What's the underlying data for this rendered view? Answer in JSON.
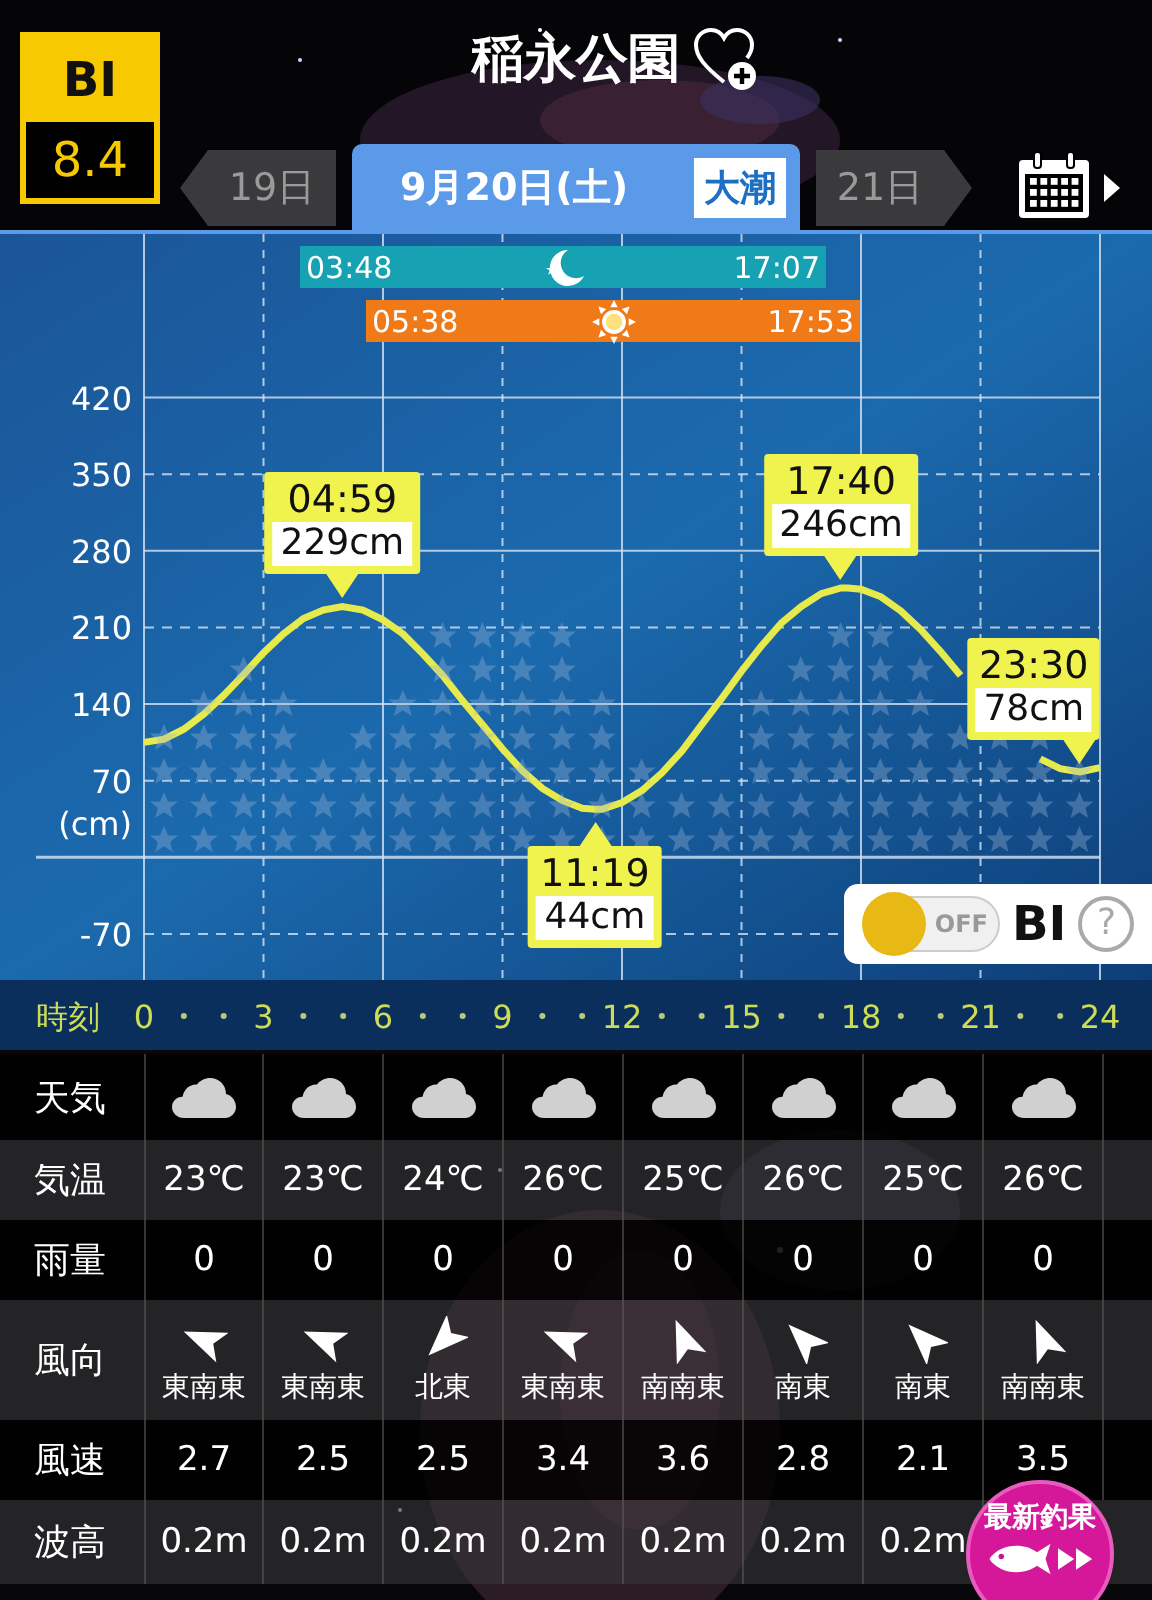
{
  "bi_badge": {
    "label": "BI",
    "score": "8.4"
  },
  "title": "稲永公園",
  "date_tabs": [
    {
      "kind": "prev",
      "label": "19日",
      "selected": false
    },
    {
      "kind": "current",
      "label": "9月20日(土)",
      "tide": "大潮",
      "selected": true
    },
    {
      "kind": "next",
      "label": "21日",
      "selected": false
    }
  ],
  "sun_moon": [
    {
      "kind": "moon",
      "rise": "03:48",
      "set": "17:07"
    },
    {
      "kind": "sun",
      "rise": "05:38",
      "set": "17:53"
    }
  ],
  "tide_chart": {
    "chart_data": {
      "type": "line",
      "xlabel": "時刻",
      "ylabel": "(cm)",
      "grid": true,
      "x": [
        0,
        0.5,
        1,
        1.5,
        2,
        2.5,
        3,
        3.5,
        4,
        4.5,
        4.98,
        5.5,
        6,
        6.5,
        7,
        7.5,
        8,
        8.5,
        9,
        9.5,
        10,
        10.5,
        11,
        11.32,
        11.5,
        12,
        12.5,
        13,
        13.5,
        14,
        14.5,
        15,
        15.5,
        16,
        16.5,
        17,
        17.5,
        17.67,
        18,
        18.5,
        19,
        19.5,
        20,
        20.5,
        21,
        21.5,
        22,
        22.5,
        23,
        23.5,
        24
      ],
      "series": [
        {
          "color": "#e6ea4c",
          "values": [
            105,
            108,
            117,
            131,
            148,
            167,
            187,
            204,
            218,
            226,
            229,
            226,
            217,
            204,
            186,
            166,
            143,
            121,
            99,
            79,
            63,
            52,
            45,
            44,
            44,
            50,
            61,
            77,
            97,
            121,
            145,
            170,
            193,
            214,
            229,
            241,
            246,
            246,
            245,
            238,
            225,
            208,
            188,
            166,
            null,
            null,
            null,
            90,
            81,
            78,
            82
          ]
        }
      ],
      "xlim": [
        0,
        24
      ],
      "ylim": [
        -112,
        573
      ],
      "xticks": [
        0,
        3,
        6,
        9,
        12,
        15,
        18,
        21,
        24
      ],
      "yticks": [
        -70,
        70,
        140,
        210,
        280,
        350,
        420
      ]
    }
  },
  "tide_extremes": [
    {
      "time": "04:59",
      "height": "229cm"
    },
    {
      "time": "11:19",
      "height": "44cm"
    },
    {
      "time": "17:40",
      "height": "246cm"
    },
    {
      "time": "23:30",
      "height": "78cm"
    }
  ],
  "bi_toggle": {
    "on": false,
    "state_label": "OFF",
    "label": "BI",
    "help": "?"
  },
  "weather_table": {
    "rows": [
      {
        "label": "天気",
        "kind": "weather",
        "cells": [
          {
            "kind": "cloudy"
          },
          {
            "kind": "cloudy"
          },
          {
            "kind": "cloudy"
          },
          {
            "kind": "cloudy"
          },
          {
            "kind": "cloudy"
          },
          {
            "kind": "cloudy"
          },
          {
            "kind": "cloudy"
          },
          {
            "kind": "cloudy"
          }
        ]
      },
      {
        "label": "気温",
        "kind": "text",
        "cells": [
          "23℃",
          "23℃",
          "24℃",
          "26℃",
          "25℃",
          "26℃",
          "25℃",
          "26℃"
        ]
      },
      {
        "label": "雨量",
        "kind": "text",
        "cells": [
          "0",
          "0",
          "0",
          "0",
          "0",
          "0",
          "0",
          "0"
        ]
      },
      {
        "label": "風向",
        "kind": "wind",
        "cells": [
          {
            "kind": "wnw",
            "text": "東南東"
          },
          {
            "kind": "wnw",
            "text": "東南東"
          },
          {
            "kind": "sw",
            "text": "北東"
          },
          {
            "kind": "wnw",
            "text": "東南東"
          },
          {
            "kind": "nnw",
            "text": "南南東"
          },
          {
            "kind": "nw",
            "text": "南東"
          },
          {
            "kind": "nw",
            "text": "南東"
          },
          {
            "kind": "nnw",
            "text": "南南東"
          }
        ]
      },
      {
        "label": "風速",
        "kind": "text",
        "cells": [
          "2.7",
          "2.5",
          "2.5",
          "3.4",
          "3.6",
          "2.8",
          "2.1",
          "3.5"
        ]
      },
      {
        "label": "波高",
        "kind": "text",
        "cells": [
          "0.2m",
          "0.2m",
          "0.2m",
          "0.2m",
          "0.2m",
          "0.2m",
          "0.2m"
        ]
      }
    ]
  },
  "latest_catch_button": {
    "label": "最新釣果"
  }
}
